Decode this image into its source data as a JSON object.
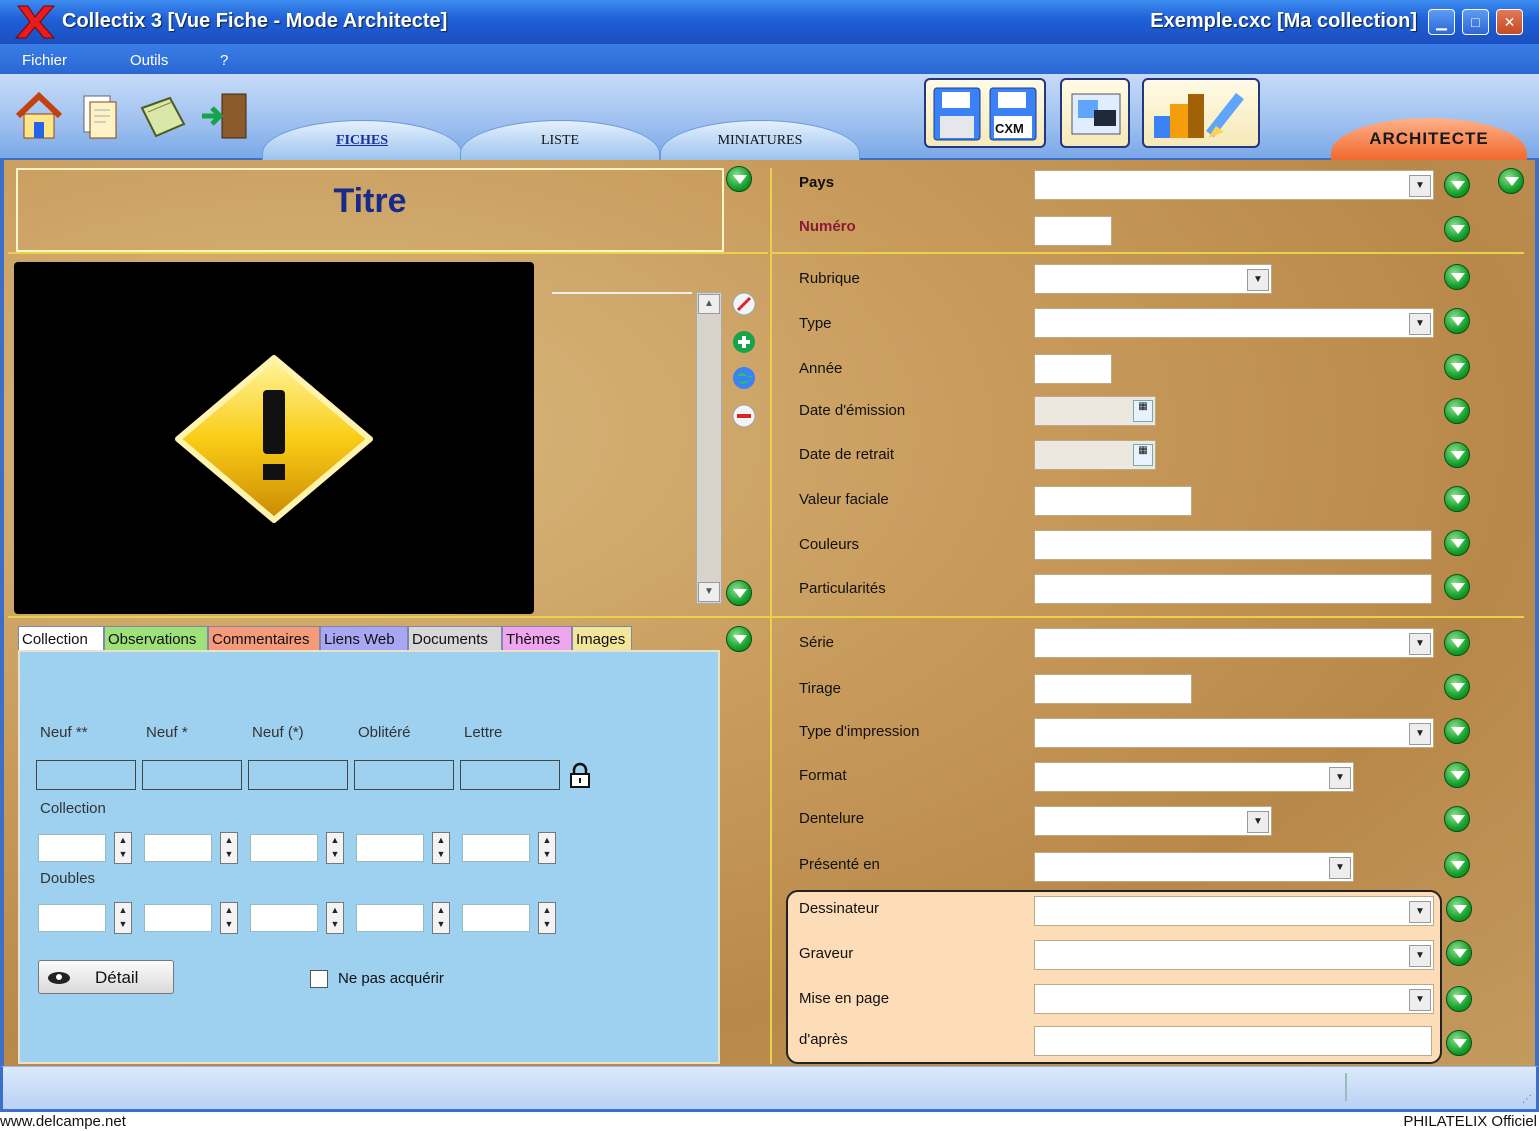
{
  "window": {
    "title": "Collectix 3 [Vue Fiche - Mode Architecte]",
    "file": "Exemple.cxc [Ma collection]"
  },
  "menu": [
    "Fichier",
    "Outils",
    "?"
  ],
  "tabs": [
    {
      "label": "FICHES",
      "active": true
    },
    {
      "label": "LISTE",
      "active": false
    },
    {
      "label": "MINIATURES",
      "active": false
    }
  ],
  "toolbar": {
    "cxm_label": "CXM",
    "architecte_label": "ARCHITECTE",
    "icons": [
      "home-icon",
      "documents-icon",
      "notebook-icon",
      "exit-door-icon",
      "save-icon",
      "save-cxm-icon",
      "stamp-card-icon",
      "themes-brush-icon"
    ]
  },
  "card": {
    "title": "Titre"
  },
  "fields": {
    "pays": "Pays",
    "numero": "Numéro",
    "rubrique": "Rubrique",
    "type": "Type",
    "annee": "Année",
    "date_emission": "Date d'émission",
    "date_retrait": "Date de retrait",
    "valeur_faciale": "Valeur faciale",
    "couleurs": "Couleurs",
    "particularites": "Particularités",
    "serie": "Série",
    "tirage": "Tirage",
    "type_impression": "Type d'impression",
    "format": "Format",
    "dentelure": "Dentelure",
    "presente_en": "Présenté en",
    "dessinateur": "Dessinateur",
    "graveur": "Graveur",
    "mise_en_page": "Mise en page",
    "dapres": "d'après"
  },
  "collection_tabs": [
    {
      "label": "Collection",
      "color": "#ffffff"
    },
    {
      "label": "Observations",
      "color": "#9ee07a"
    },
    {
      "label": "Commentaires",
      "color": "#f59a7a"
    },
    {
      "label": "Liens Web",
      "color": "#a9a7f3"
    },
    {
      "label": "Documents",
      "color": "#d8d8d8"
    },
    {
      "label": "Thèmes",
      "color": "#f0a6ee"
    },
    {
      "label": "Images",
      "color": "#f3e59a"
    }
  ],
  "collection": {
    "columns": [
      "Neuf **",
      "Neuf *",
      "Neuf (*)",
      "Oblitéré",
      "Lettre"
    ],
    "collection_label": "Collection",
    "doubles_label": "Doubles",
    "detail_label": "Détail",
    "no_acquire_label": "Ne pas acquérir",
    "no_acquire_checked": false
  },
  "footer": {
    "left": "www.delcampe.net",
    "right": "PHILATELIX Officiel"
  }
}
